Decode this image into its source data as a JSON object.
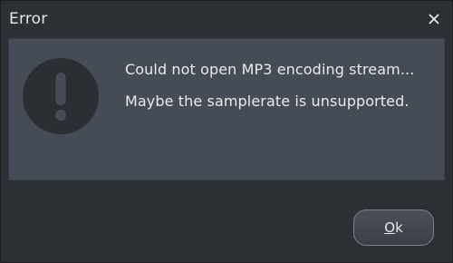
{
  "dialog": {
    "title": "Error",
    "close_icon": "close-icon",
    "alert_icon": "exclamation-circle-icon",
    "messages": [
      "Could not open MP3 encoding stream...",
      "Maybe the samplerate is unsupported."
    ],
    "ok_label_mnemonic": "O",
    "ok_label_rest": "k"
  }
}
